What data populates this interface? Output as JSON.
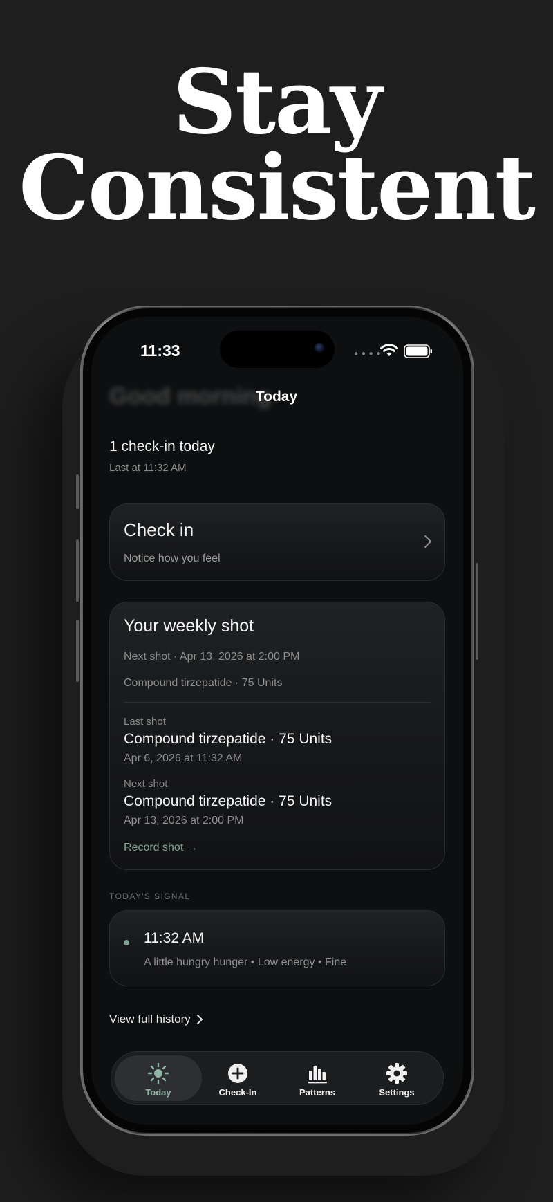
{
  "headline": {
    "line1": "Stay",
    "line2": "Consistent"
  },
  "status_bar": {
    "time": "11:33",
    "icons": [
      "wifi-icon",
      "battery-icon"
    ]
  },
  "nav": {
    "title": "Today",
    "greeting_blurred": "Good morning"
  },
  "summary": {
    "title": "1 check-in today",
    "subtitle": "Last at 11:32 AM"
  },
  "checkin_card": {
    "title": "Check in",
    "subtitle": "Notice how you feel"
  },
  "weekly_card": {
    "title": "Your weekly shot",
    "next_line": "Next shot · Apr 13, 2026 at 2:00 PM",
    "med_line": "Compound tirzepatide · 75 Units",
    "last": {
      "label": "Last shot",
      "med": "Compound tirzepatide · 75 Units",
      "date": "Apr 6, 2026 at 11:32 AM"
    },
    "next": {
      "label": "Next shot",
      "med": "Compound tirzepatide · 75 Units",
      "date": "Apr 13, 2026 at 2:00 PM"
    },
    "record_link": "Record shot →"
  },
  "signal": {
    "section_label": "TODAY'S SIGNAL",
    "time": "11:32 AM",
    "description": "A little hungry hunger • Low energy • Fine"
  },
  "history_link": "View full history",
  "tabbar": {
    "tabs": [
      {
        "label": "Today",
        "icon": "sun-icon",
        "active": true
      },
      {
        "label": "Check-In",
        "icon": "plus-circle-icon",
        "active": false
      },
      {
        "label": "Patterns",
        "icon": "bar-chart-icon",
        "active": false
      },
      {
        "label": "Settings",
        "icon": "gear-icon",
        "active": false
      }
    ]
  },
  "colors": {
    "background": "#1e1e1e",
    "screen": "#0e0f10",
    "accent": "#7fa393",
    "card": "#1a1b1d"
  }
}
